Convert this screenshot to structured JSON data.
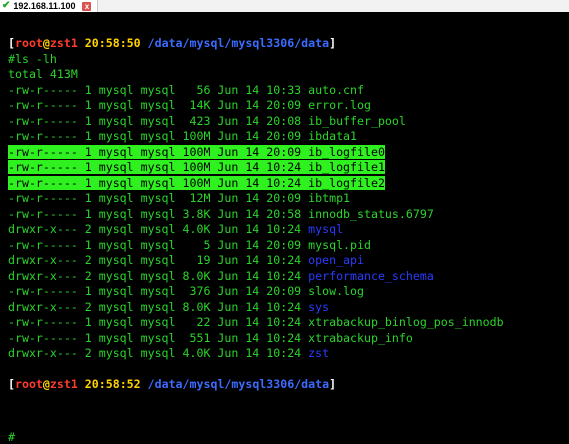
{
  "tab": {
    "title": "192.168.11.100",
    "close_label": "x"
  },
  "prompt1": {
    "user": "root",
    "host": "zst1",
    "time": "20:58:50",
    "path": "/data/mysql/mysql3306/data"
  },
  "command": "#ls -lh",
  "total": "total 413M",
  "files": [
    {
      "perm": "-rw-r-----",
      "links": "1",
      "owner": "mysql",
      "group": "mysql",
      "size": "56",
      "month": "Jun",
      "day": "14",
      "time": "10:33",
      "name": "auto.cnf",
      "dir": false,
      "highlight": false
    },
    {
      "perm": "-rw-r-----",
      "links": "1",
      "owner": "mysql",
      "group": "mysql",
      "size": "14K",
      "month": "Jun",
      "day": "14",
      "time": "20:09",
      "name": "error.log",
      "dir": false,
      "highlight": false
    },
    {
      "perm": "-rw-r-----",
      "links": "1",
      "owner": "mysql",
      "group": "mysql",
      "size": "423",
      "month": "Jun",
      "day": "14",
      "time": "20:08",
      "name": "ib_buffer_pool",
      "dir": false,
      "highlight": false
    },
    {
      "perm": "-rw-r-----",
      "links": "1",
      "owner": "mysql",
      "group": "mysql",
      "size": "100M",
      "month": "Jun",
      "day": "14",
      "time": "20:09",
      "name": "ibdata1",
      "dir": false,
      "highlight": false
    },
    {
      "perm": "-rw-r-----",
      "links": "1",
      "owner": "mysql",
      "group": "mysql",
      "size": "100M",
      "month": "Jun",
      "day": "14",
      "time": "20:09",
      "name": "ib_logfile0",
      "dir": false,
      "highlight": true
    },
    {
      "perm": "-rw-r-----",
      "links": "1",
      "owner": "mysql",
      "group": "mysql",
      "size": "100M",
      "month": "Jun",
      "day": "14",
      "time": "10:24",
      "name": "ib_logfile1",
      "dir": false,
      "highlight": true
    },
    {
      "perm": "-rw-r-----",
      "links": "1",
      "owner": "mysql",
      "group": "mysql",
      "size": "100M",
      "month": "Jun",
      "day": "14",
      "time": "10:24",
      "name": "ib_logfile2",
      "dir": false,
      "highlight": true
    },
    {
      "perm": "-rw-r-----",
      "links": "1",
      "owner": "mysql",
      "group": "mysql",
      "size": "12M",
      "month": "Jun",
      "day": "14",
      "time": "20:09",
      "name": "ibtmp1",
      "dir": false,
      "highlight": false
    },
    {
      "perm": "-rw-r-----",
      "links": "1",
      "owner": "mysql",
      "group": "mysql",
      "size": "3.8K",
      "month": "Jun",
      "day": "14",
      "time": "20:58",
      "name": "innodb_status.6797",
      "dir": false,
      "highlight": false
    },
    {
      "perm": "drwxr-x---",
      "links": "2",
      "owner": "mysql",
      "group": "mysql",
      "size": "4.0K",
      "month": "Jun",
      "day": "14",
      "time": "10:24",
      "name": "mysql",
      "dir": true,
      "highlight": false
    },
    {
      "perm": "-rw-r-----",
      "links": "1",
      "owner": "mysql",
      "group": "mysql",
      "size": "5",
      "month": "Jun",
      "day": "14",
      "time": "20:09",
      "name": "mysql.pid",
      "dir": false,
      "highlight": false
    },
    {
      "perm": "drwxr-x---",
      "links": "2",
      "owner": "mysql",
      "group": "mysql",
      "size": "19",
      "month": "Jun",
      "day": "14",
      "time": "10:24",
      "name": "open_api",
      "dir": true,
      "highlight": false
    },
    {
      "perm": "drwxr-x---",
      "links": "2",
      "owner": "mysql",
      "group": "mysql",
      "size": "8.0K",
      "month": "Jun",
      "day": "14",
      "time": "10:24",
      "name": "performance_schema",
      "dir": true,
      "highlight": false
    },
    {
      "perm": "-rw-r-----",
      "links": "1",
      "owner": "mysql",
      "group": "mysql",
      "size": "376",
      "month": "Jun",
      "day": "14",
      "time": "20:09",
      "name": "slow.log",
      "dir": false,
      "highlight": false
    },
    {
      "perm": "drwxr-x---",
      "links": "2",
      "owner": "mysql",
      "group": "mysql",
      "size": "8.0K",
      "month": "Jun",
      "day": "14",
      "time": "10:24",
      "name": "sys",
      "dir": true,
      "highlight": false
    },
    {
      "perm": "-rw-r-----",
      "links": "1",
      "owner": "mysql",
      "group": "mysql",
      "size": "22",
      "month": "Jun",
      "day": "14",
      "time": "10:24",
      "name": "xtrabackup_binlog_pos_innodb",
      "dir": false,
      "highlight": false
    },
    {
      "perm": "-rw-r-----",
      "links": "1",
      "owner": "mysql",
      "group": "mysql",
      "size": "551",
      "month": "Jun",
      "day": "14",
      "time": "10:24",
      "name": "xtrabackup_info",
      "dir": false,
      "highlight": false
    },
    {
      "perm": "drwxr-x---",
      "links": "2",
      "owner": "mysql",
      "group": "mysql",
      "size": "4.0K",
      "month": "Jun",
      "day": "14",
      "time": "10:24",
      "name": "zst",
      "dir": true,
      "highlight": false
    }
  ],
  "prompt2": {
    "user": "root",
    "host": "zst1",
    "time": "20:58:52",
    "path": "/data/mysql/mysql3306/data"
  },
  "cursor": "#",
  "colors": {
    "background": "#000000",
    "text": "#2bd42b",
    "highlight_bg": "#2ef11f",
    "directory": "#2a3bff",
    "prompt_user": "#ff3b30",
    "prompt_time": "#ffd200",
    "prompt_path": "#3b6cff"
  },
  "icons": {
    "tab_status": "check-icon",
    "tab_close": "close-icon"
  }
}
